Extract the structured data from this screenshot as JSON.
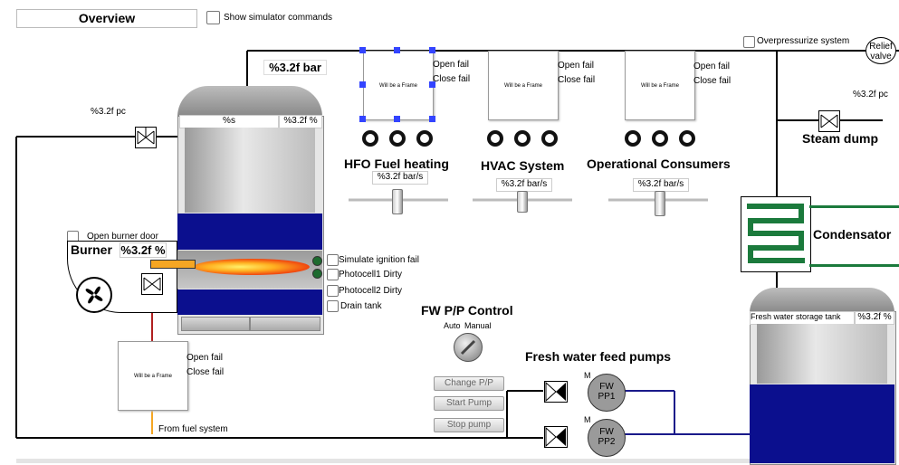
{
  "header": {
    "title": "Overview",
    "show_sim_cmd_label": "Show simulator commands"
  },
  "top_valve": {
    "pressure": "%3.2f bar",
    "pc_label": "%3.2f pc"
  },
  "frames": {
    "placeholder": "Will be a Frame"
  },
  "fail_labels": {
    "open": "Open fail",
    "close": "Close fail"
  },
  "consumers": [
    {
      "name": "HFO Fuel heating",
      "value": "%3.2f bar/s"
    },
    {
      "name": "HVAC System",
      "value": "%3.2f bar/s"
    },
    {
      "name": "Operational Consumers",
      "value": "%3.2f bar/s"
    }
  ],
  "relief": {
    "overpressurize_label": "Overpressurize system",
    "relief_valve_label": "Relief valve",
    "pc_label": "%3.2f pc",
    "steam_dump_label": "Steam dump"
  },
  "boiler": {
    "level_text": "%s",
    "level_percent": "%3.2f %"
  },
  "burner": {
    "open_door_label": "Open burner door",
    "title": "Burner",
    "percent": "%3.2f %",
    "options": [
      "Simulate ignition fail",
      "Photocell1 Dirty",
      "Photocell2 Dirty",
      "Drain tank"
    ]
  },
  "fuel": {
    "from_label": "From fuel system"
  },
  "condensator": {
    "label": "Condensator"
  },
  "tank": {
    "name": "Fresh water storage tank",
    "percent": "%3.2f %"
  },
  "fw_control": {
    "title": "FW P/P Control",
    "mode_auto": "Auto",
    "mode_manual": "Manual",
    "buttons": [
      "Change P/P",
      "Start Pump",
      "Stop pump"
    ]
  },
  "pumps": {
    "title": "Fresh water feed pumps",
    "motor_label": "M",
    "items": [
      {
        "name_line1": "FW",
        "name_line2": "PP1"
      },
      {
        "name_line1": "FW",
        "name_line2": "PP2"
      }
    ]
  },
  "colors": {
    "water": "#0b0f8e",
    "condensator": "#1b7a3c",
    "fuel_line": "#f5a623",
    "drain_line": "#b02020"
  }
}
